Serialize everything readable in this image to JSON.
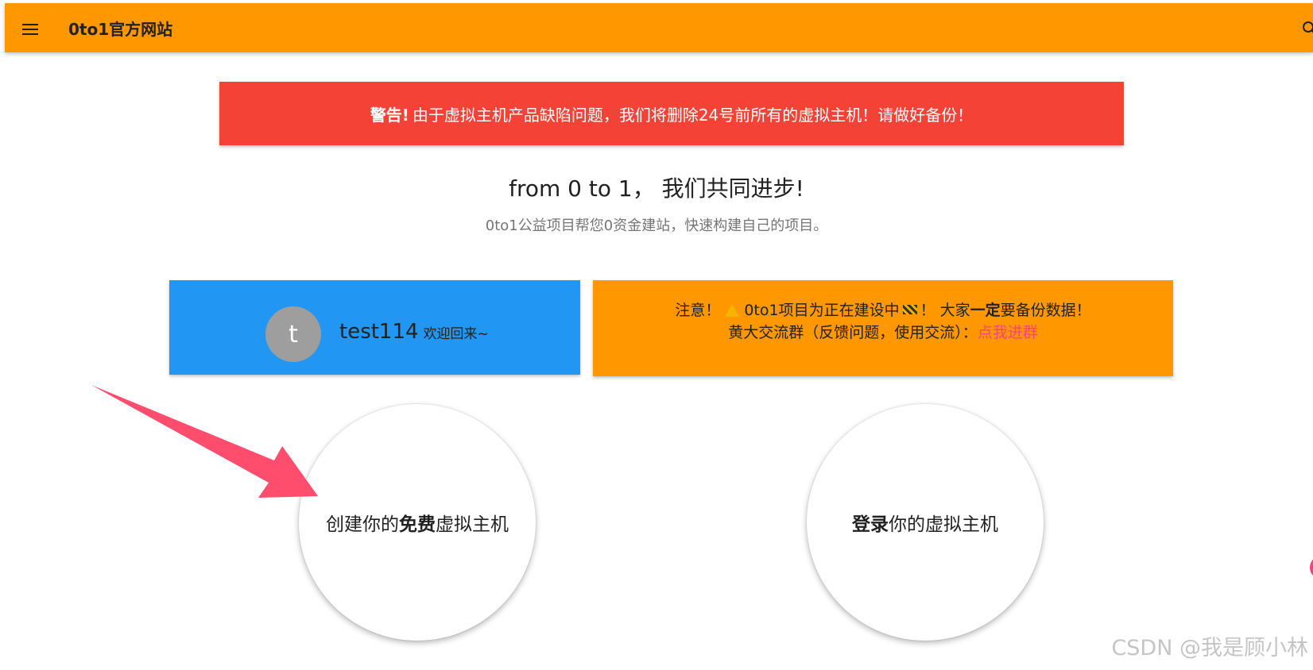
{
  "header": {
    "title": "0to1官方网站",
    "menu_icon": "menu-icon",
    "search_icon": "search-icon",
    "color": "#ff9800"
  },
  "warning": {
    "label": "警告!",
    "message": "由于虚拟主机产品缺陷问题，我们将删除24号前所有的虚拟主机！请做好备份！",
    "color": "#f44336"
  },
  "hero": {
    "title": "from 0 to 1， 我们共同进步!",
    "subtitle": "0to1公益项目帮您0资金建站，快速构建自己的项目。"
  },
  "user_card": {
    "avatar_letter": "t",
    "username": "test114",
    "welcome": "欢迎回来~",
    "color": "#2196f3"
  },
  "notice": {
    "prefix": "注意！",
    "warning_icon": "warning-icon",
    "middle": "0to1项目为正在建设中",
    "construction_icon": "construction-icon",
    "mid2": "！ 大家",
    "bold": "一定",
    "suffix": "要备份数据！",
    "line2_prefix": "黄大交流群（反馈问题，使用交流）：",
    "link": "点我进群",
    "link_color": "#ff4081"
  },
  "actions": {
    "create_pre": "创建你的",
    "create_bold": "免费",
    "create_post": "虚拟主机",
    "login_bold": "登录",
    "login_post": "你的虚拟主机"
  },
  "watermark": "CSDN @我是顾小林",
  "arrow_color": "#ff4d6d"
}
